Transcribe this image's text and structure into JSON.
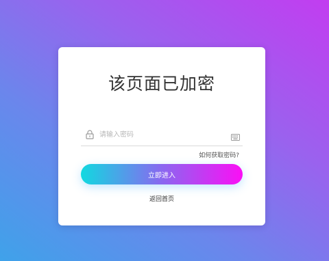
{
  "card": {
    "title": "该页面已加密",
    "password": {
      "placeholder": "请输入密码",
      "value": ""
    },
    "forgot_label": "如何获取密码?",
    "enter_label": "立即进入",
    "home_label": "返回首页",
    "icons": {
      "lock": "lock-icon",
      "keyboard": "keyboard-icon"
    }
  },
  "colors": {
    "background_start": "#3fa2ea",
    "background_end": "#c23df0",
    "button_start": "#11d9e0",
    "button_end": "#fb0ff5"
  }
}
